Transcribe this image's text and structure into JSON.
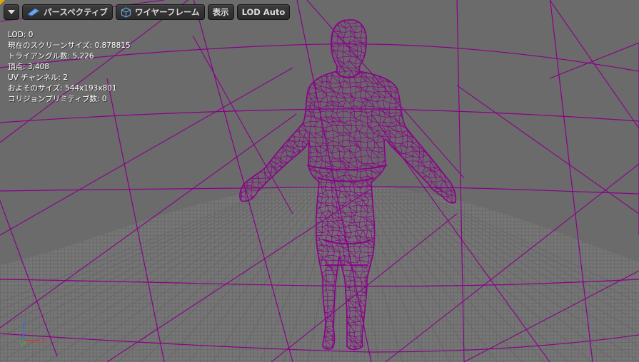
{
  "toolbar": {
    "menu_icon": "chevron-down-icon",
    "perspective_label": "パースペクティブ",
    "perspective_icon": "camera-icon",
    "wireframe_label": "ワイヤーフレーム",
    "wireframe_icon": "cube-icon",
    "show_label": "表示",
    "lod_label": "LOD Auto"
  },
  "stats": {
    "lines": [
      "LOD: 0",
      "現在のスクリーンサイズ: 0.878815",
      "トライアングル数: 5,226",
      "頂点: 3,408",
      "UV チャンネル: 2",
      "およそのサイズ: 544x193x801",
      "コリジョンプリミティブ数: 0"
    ]
  },
  "axis": {
    "z": "Z",
    "x": "X",
    "y": "Y"
  },
  "colors": {
    "background": "#6b6b6b",
    "wireframe": "#8b008b",
    "floor_grid": "#5a5a5a",
    "axis_x": "#d43a2a",
    "axis_y": "#3cb43c",
    "axis_z": "#3a6ed4"
  }
}
